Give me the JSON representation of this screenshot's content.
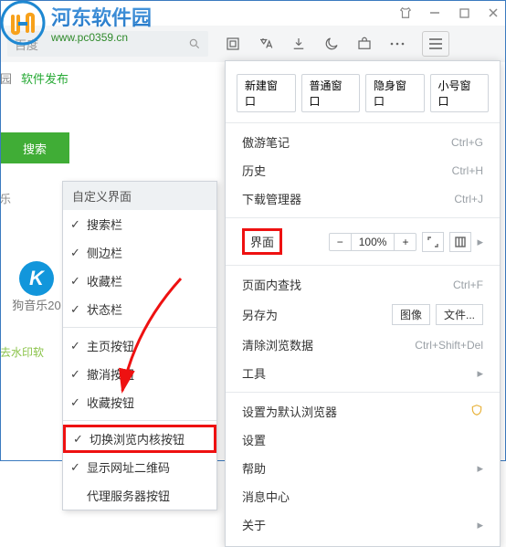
{
  "logo": {
    "name": "河东软件园",
    "url": "www.pc0359.cn"
  },
  "titlebar": {},
  "toolbar": {
    "address_hint": "百度"
  },
  "breadcrumb": {
    "a": "园",
    "b": "软件发布"
  },
  "search_btn": "搜索",
  "tab_music": "乐",
  "kugou_label": "狗音乐20",
  "watermark2": "去水印软",
  "submenu": {
    "title": "自定义界面",
    "items": [
      {
        "label": "搜索栏",
        "chk": true
      },
      {
        "label": "侧边栏",
        "chk": true
      },
      {
        "label": "收藏栏",
        "chk": true
      },
      {
        "label": "状态栏",
        "chk": true
      },
      {
        "label": "主页按钮",
        "chk": true
      },
      {
        "label": "撤消按钮",
        "chk": true
      },
      {
        "label": "收藏按钮",
        "chk": true
      },
      {
        "label": "切换浏览内核按钮",
        "chk": true,
        "hl": true
      },
      {
        "label": "显示网址二维码",
        "chk": true
      },
      {
        "label": "代理服务器按钮",
        "chk": false
      }
    ]
  },
  "mainmenu": {
    "windows": [
      "新建窗口",
      "普通窗口",
      "隐身窗口",
      "小号窗口"
    ],
    "note": {
      "label": "傲游笔记",
      "sc": "Ctrl+G"
    },
    "history": {
      "label": "历史",
      "sc": "Ctrl+H"
    },
    "dlmgr": {
      "label": "下载管理器",
      "sc": "Ctrl+J"
    },
    "ui": {
      "label": "界面",
      "zoom": "100%",
      "minus": "−",
      "plus": "+",
      "triangle": "▸"
    },
    "find": {
      "label": "页面内查找",
      "sc": "Ctrl+F"
    },
    "saveas": {
      "label": "另存为",
      "img": "图像",
      "file": "文件..."
    },
    "clear": {
      "label": "清除浏览数据",
      "sc": "Ctrl+Shift+Del"
    },
    "tools": {
      "label": "工具"
    },
    "default": {
      "label": "设置为默认浏览器"
    },
    "settings": {
      "label": "设置"
    },
    "help": {
      "label": "帮助"
    },
    "msg": {
      "label": "消息中心"
    },
    "about": {
      "label": "关于"
    }
  }
}
